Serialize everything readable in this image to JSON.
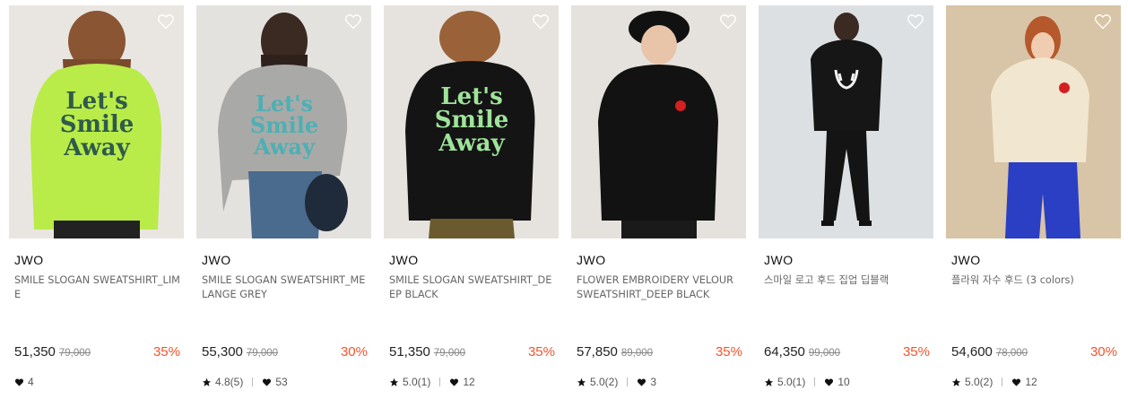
{
  "colors": {
    "discount": "#f2532c",
    "text": "#222222",
    "muted": "#888888"
  },
  "products": [
    {
      "brand": "JWO",
      "name": "SMILE SLOGAN SWEATSHIRT_LIME",
      "price": "51,350",
      "original_price": "79,000",
      "discount": "35%",
      "rating": "",
      "likes": "4",
      "image": {
        "bg": "#e9e6e1",
        "garment": "#b9ec48",
        "print": "#2f5a4c",
        "print_text": [
          "Let's",
          "Smile",
          "Away"
        ]
      }
    },
    {
      "brand": "JWO",
      "name": "SMILE SLOGAN SWEATSHIRT_MELANGE GREY",
      "price": "55,300",
      "original_price": "79,000",
      "discount": "30%",
      "rating": "4.8(5)",
      "likes": "53",
      "image": {
        "bg": "#e4e2df",
        "garment": "#a9a9a7",
        "print": "#4cb0b4",
        "print_text": [
          "Let's",
          "Smile",
          "Away"
        ]
      }
    },
    {
      "brand": "JWO",
      "name": "SMILE SLOGAN SWEATSHIRT_DEEP BLACK",
      "price": "51,350",
      "original_price": "79,000",
      "discount": "35%",
      "rating": "5.0(1)",
      "likes": "12",
      "image": {
        "bg": "#e6e3de",
        "garment": "#141414",
        "print": "#9fe39b",
        "print_text": [
          "Let's",
          "Smile",
          "Away"
        ]
      }
    },
    {
      "brand": "JWO",
      "name": "FLOWER EMBROIDERY VELOUR SWEATSHIRT_DEEP BLACK",
      "price": "57,850",
      "original_price": "89,000",
      "discount": "35%",
      "rating": "5.0(2)",
      "likes": "3",
      "image": {
        "bg": "#e5e2dd",
        "garment": "#121212",
        "print": "#d42020",
        "print_text": []
      }
    },
    {
      "brand": "JWO",
      "name": "스마일 로고 후드 집업 딥블랙",
      "price": "64,350",
      "original_price": "99,000",
      "discount": "35%",
      "rating": "5.0(1)",
      "likes": "10",
      "image": {
        "bg": "#dde0e2",
        "garment": "#161616",
        "print": "#f2f2f2",
        "print_text": []
      }
    },
    {
      "brand": "JWO",
      "name": "플라워 자수 후드 (3 colors)",
      "price": "54,600",
      "original_price": "78,000",
      "discount": "30%",
      "rating": "5.0(2)",
      "likes": "12",
      "image": {
        "bg": "#d8c4a6",
        "garment": "#f1e6cf",
        "print": "#d42020",
        "print_text": []
      }
    }
  ]
}
